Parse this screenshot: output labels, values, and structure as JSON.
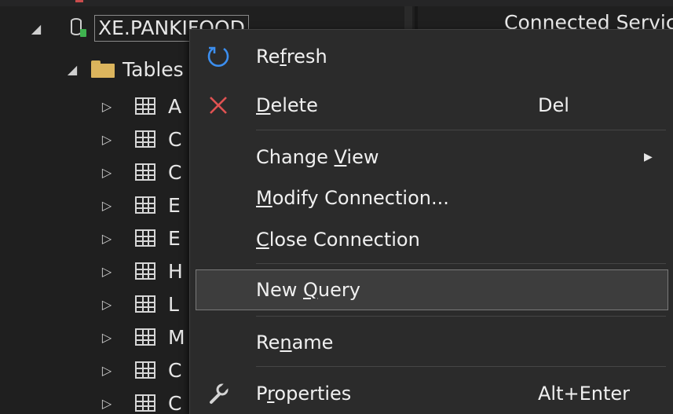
{
  "explorer": {
    "db_name": "XE.PANKIFOOD",
    "tables_label": "Tables",
    "table_initials": [
      "A",
      "C",
      "C",
      "E",
      "E",
      "H",
      "L",
      "M",
      "C",
      "C"
    ]
  },
  "right_pane": {
    "header": "Connected Servic"
  },
  "context_menu": {
    "items": [
      {
        "label_pre": "Re",
        "label_u": "f",
        "label_post": "resh",
        "shortcut": "",
        "icon": "refresh-icon"
      },
      {
        "label_pre": "",
        "label_u": "D",
        "label_post": "elete",
        "shortcut": "Del",
        "icon": "delete-x-icon"
      },
      {
        "label_pre": "Change ",
        "label_u": "V",
        "label_post": "iew",
        "shortcut": "",
        "icon": ""
      },
      {
        "label_pre": "",
        "label_u": "M",
        "label_post": "odify Connection...",
        "shortcut": "",
        "icon": ""
      },
      {
        "label_pre": "",
        "label_u": "C",
        "label_post": "lose Connection",
        "shortcut": "",
        "icon": ""
      },
      {
        "label_pre": "New ",
        "label_u": "Q",
        "label_post": "uery",
        "shortcut": "",
        "icon": ""
      },
      {
        "label_pre": "Re",
        "label_u": "n",
        "label_post": "ame",
        "shortcut": "",
        "icon": ""
      },
      {
        "label_pre": "P",
        "label_u": "r",
        "label_post": "operties",
        "shortcut": "Alt+Enter",
        "icon": "wrench-icon"
      }
    ]
  },
  "colors": {
    "background": "#1f1f1f",
    "menu_bg": "#2b2b2b",
    "highlight": "#3d3d3d",
    "refresh_blue": "#3c8ff0",
    "delete_red": "#e05252",
    "folder_yellow": "#dcb55d",
    "plug_green": "#3fb34f"
  }
}
